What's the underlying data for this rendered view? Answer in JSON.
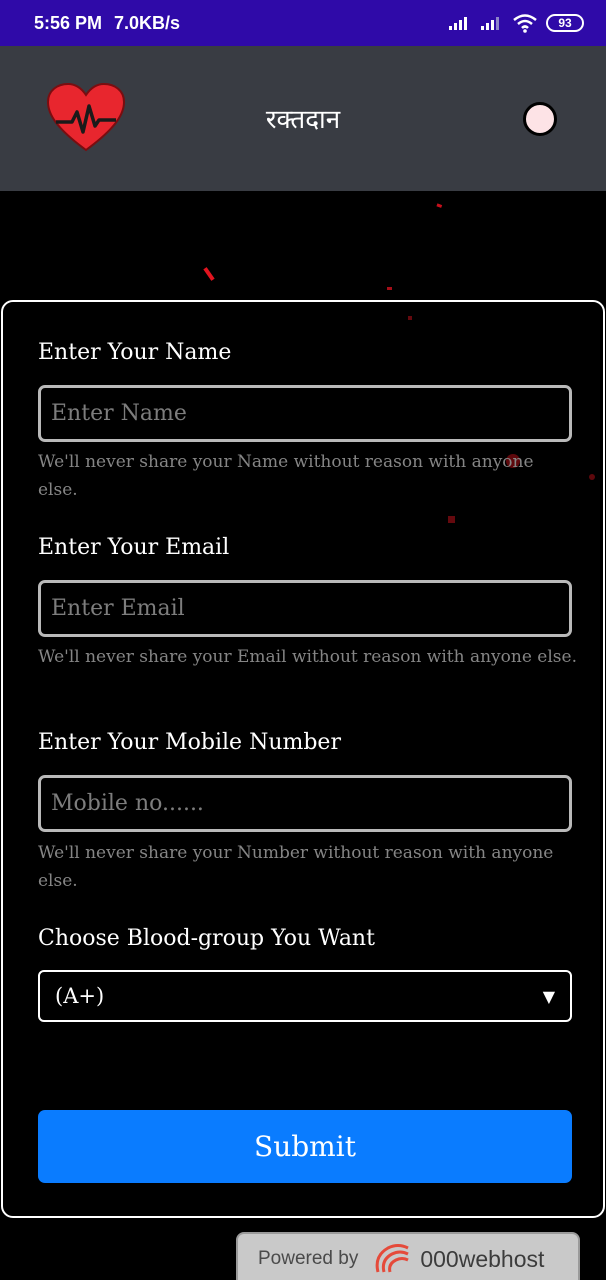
{
  "status_bar": {
    "time": "5:56 PM",
    "speed": "7.0KB/s",
    "battery": "93",
    "icons": [
      "signal-icon",
      "signal-icon",
      "wifi-icon",
      "battery-icon"
    ]
  },
  "header": {
    "logo_icon": "heart-pulse-icon",
    "title": "रक्तदान",
    "toggle_icon": "theme-toggle"
  },
  "form": {
    "name": {
      "label": "Enter Your Name",
      "placeholder": "Enter Name",
      "value": "",
      "help": "We'll never share your Name without reason with anyone else."
    },
    "email": {
      "label": "Enter Your Email",
      "placeholder": "Enter Email",
      "value": "",
      "help": "We'll never share your Email without reason with anyone else."
    },
    "mobile": {
      "label": "Enter Your Mobile Number",
      "placeholder": "Mobile no......",
      "value": "",
      "help": "We'll never share your Number without reason with anyone else."
    },
    "blood_group": {
      "label": "Choose Blood-group You Want",
      "selected": "(A+)"
    },
    "submit_label": "Submit"
  },
  "footer": {
    "powered_by": "Powered by",
    "brand": "000webhost"
  },
  "colors": {
    "status_bar": "#2f0aa8",
    "header": "#393c43",
    "background": "#000000",
    "submit": "#0a7cff",
    "accent": "#e8262e"
  }
}
